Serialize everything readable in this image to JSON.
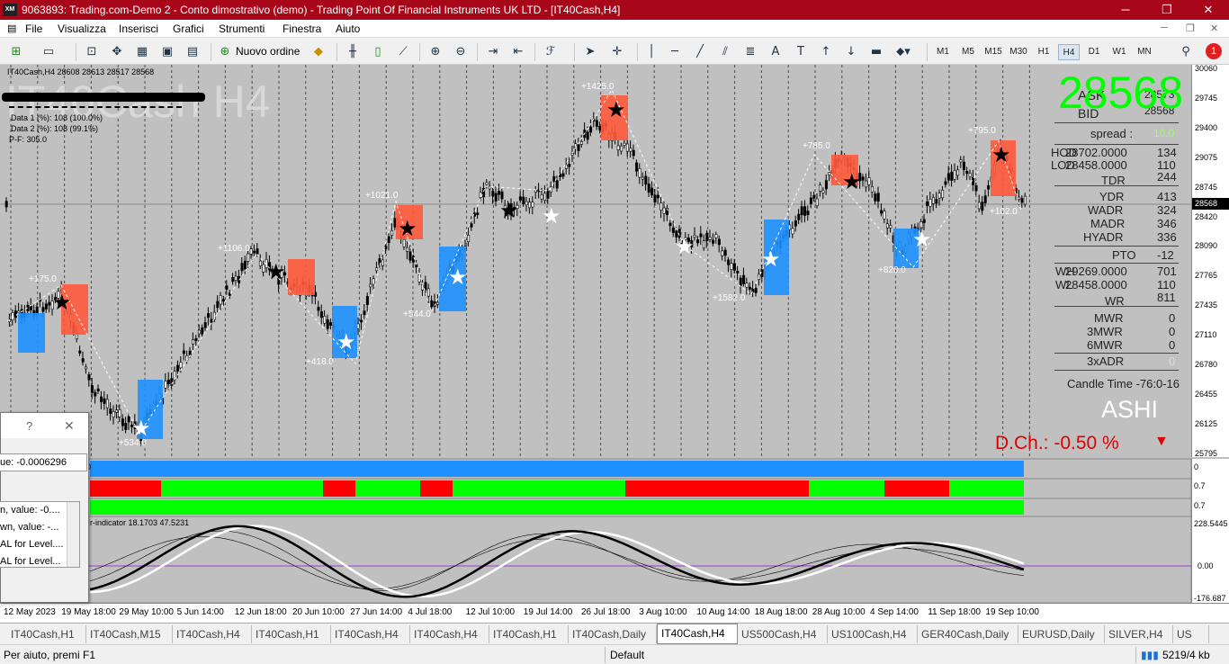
{
  "window": {
    "logo": "XM",
    "title": "9063893: Trading.com-Demo 2 - Conto dimostrativo (demo) - Trading Point Of Financial Instruments UK LTD - [IT40Cash,H4]"
  },
  "menu": [
    "File",
    "Visualizza",
    "Inserisci",
    "Grafici",
    "Strumenti",
    "Finestra",
    "Aiuto"
  ],
  "toolbar": {
    "new_order_label": "Nuovo ordine",
    "timeframes": [
      "M1",
      "M5",
      "M15",
      "M30",
      "H1",
      "H4",
      "D1",
      "W1",
      "MN"
    ],
    "selected_timeframe": "H4",
    "notification_count": "1"
  },
  "chart": {
    "header": "IT40Cash,H4  28608 28613 28517 28568",
    "watermark": "IT40Cash H4",
    "info_lines": [
      "Data 1 (%): 108 (100.0%)",
      "Data 2 (%): 108 (99.1%)",
      "P-F: 305.0"
    ],
    "big_price": "28568",
    "price_scale": [
      "30060",
      "29745",
      "29400",
      "29075",
      "28745",
      "28420",
      "28090",
      "27765",
      "27435",
      "27110",
      "26780",
      "26455",
      "26125",
      "25795"
    ],
    "current_price_tag": "28568",
    "time_axis": [
      "12 May 2023",
      "19 May 18:00",
      "29 May 10:00",
      "5 Jun 14:00",
      "12 Jun 18:00",
      "20 Jun 10:00",
      "27 Jun 14:00",
      "4 Jul 18:00",
      "12 Jul 10:00",
      "19 Jul 14:00",
      "26 Jul 18:00",
      "3 Aug 10:00",
      "10 Aug 14:00",
      "18 Aug 18:00",
      "28 Aug 10:00",
      "4 Sep 14:00",
      "11 Sep 18:00",
      "19 Sep 10:00"
    ],
    "swing_labels": [
      "+175.0",
      "+534.0",
      "+1106.0",
      "+418.0",
      "+1021.0",
      "+544.0",
      "+1425.0",
      "+1582.0",
      "+785.0",
      "+820.0",
      "+795.0",
      "+102.0"
    ],
    "panel": {
      "ask_label": "ASK",
      "ask_value": "28573",
      "bid_label": "BID",
      "bid_value": "28568",
      "spread_label": "spread :",
      "spread_value": "10.0",
      "hod_label": "HOD",
      "hod_value": "28702.0000",
      "hod_pts": "134",
      "lod_label": "LOD",
      "lod_value": "28458.0000",
      "lod_pts": "110",
      "tdr_label": "TDR",
      "tdr_value": "244",
      "ydr_label": "YDR",
      "ydr_value": "413",
      "wadr_label": "WADR",
      "wadr_value": "324",
      "madr_label": "MADR",
      "madr_value": "346",
      "hyadr_label": "HYADR",
      "hyadr_value": "336",
      "pto_label": "PTO",
      "pto_value": "-12",
      "wh_label": "WH",
      "wh_value": "29269.0000",
      "wh_pts": "701",
      "wl_label": "WL",
      "wl_value": "28458.0000",
      "wl_pts": "110",
      "wr_label": "WR",
      "wr_value": "811",
      "mwr_label": "MWR",
      "mwr_value": "0",
      "mwr3_label": "3MWR",
      "mwr3_value": "0",
      "mwr6_label": "6MWR",
      "mwr6_value": "0",
      "xadr_label": "3xADR",
      "xadr_value": "0",
      "candle_time": "Candle Time -76:0-16",
      "brand": "ASHI",
      "dch": "D.Ch.: -0.50 %",
      "dch_arrow": "▼"
    },
    "sub_scales": [
      "0",
      "0.7",
      "0.7"
    ],
    "oscillator_label": "r-indicator 18.1703 47.5231",
    "oscillator_scale": [
      "228.5445",
      "0.00",
      "-176.687"
    ],
    "strip1_value": "0"
  },
  "dialog": {
    "help": "?",
    "close": "✕",
    "value_line": "ue: -0.0006296",
    "list": [
      "n, value: -0....",
      "wn, value: -...",
      "AL for Level....",
      "AL for Level..."
    ]
  },
  "tabs": [
    "IT40Cash,H1",
    "IT40Cash,M15",
    "IT40Cash,H4",
    "IT40Cash,H1",
    "IT40Cash,H4",
    "IT40Cash,H4",
    "IT40Cash,H1",
    "IT40Cash,Daily",
    "IT40Cash,H4",
    "US500Cash,H4",
    "US100Cash,H4",
    "GER40Cash,Daily",
    "EURUSD,Daily",
    "SILVER,H4",
    "US"
  ],
  "active_tab_index": 8,
  "status": {
    "help": "Per aiuto, premi F1",
    "profile": "Default",
    "traffic": "5219/4 kb"
  },
  "colors": {
    "title_bar": "#a8071a",
    "chart_bg": "#c0c0c0",
    "bull_box": "#1e90ff",
    "bear_box": "#ff5a3c",
    "big_price": "#00ff00",
    "dch": "#e00000",
    "strip_blue": "#1e90ff",
    "strip_red": "#ff0000",
    "strip_green": "#00ff00"
  }
}
